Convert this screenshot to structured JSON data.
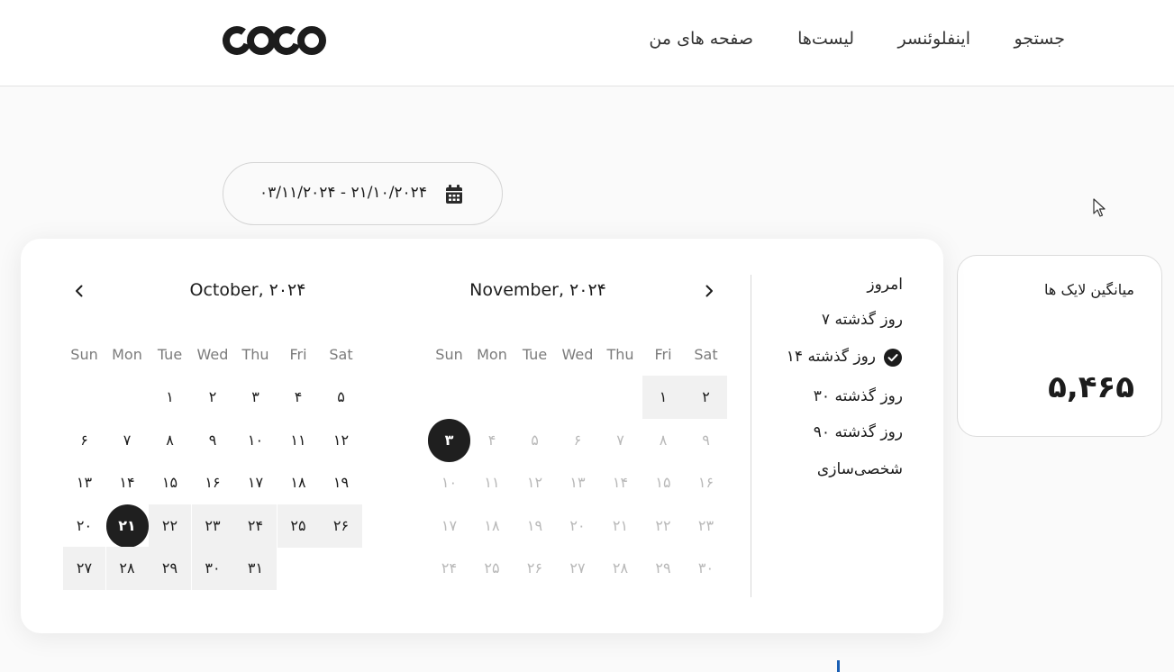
{
  "header": {
    "logo_text": "COCO",
    "nav": {
      "search": "جستجو",
      "influencer": "اینفلوئنسر",
      "lists": "لیست‌ها",
      "my_pages": "صفحه های من"
    }
  },
  "date_picker": {
    "range_text": "۰۳/۱۱/۲۰۲۴ - ۲۱/۱۰/۲۰۲۴",
    "icon": "calendar-icon"
  },
  "stat_card": {
    "title": "میانگین لایک ها",
    "value": "۵,۴۶۵"
  },
  "presets": {
    "today": "امروز",
    "last_7": "۷ روز گذشته",
    "last_14": "۱۴ روز گذشته",
    "last_30": "۳۰ روز گذشته",
    "last_90": "۹۰ روز گذشته",
    "custom": "شخصی‌سازی",
    "selected": "last_14"
  },
  "calendar": {
    "weekdays": [
      "Sun",
      "Mon",
      "Tue",
      "Wed",
      "Thu",
      "Fri",
      "Sat"
    ],
    "left": {
      "title": "October, ۲۰۲۴",
      "first_weekday": 2,
      "days": [
        "۱",
        "۲",
        "۳",
        "۴",
        "۵",
        "۶",
        "۷",
        "۸",
        "۹",
        "۱۰",
        "۱۱",
        "۱۲",
        "۱۳",
        "۱۴",
        "۱۵",
        "۱۶",
        "۱۷",
        "۱۸",
        "۱۹",
        "۲۰",
        "۲۱",
        "۲۲",
        "۲۳",
        "۲۴",
        "۲۵",
        "۲۶",
        "۲۷",
        "۲۸",
        "۲۹",
        "۳۰",
        "۳۱"
      ],
      "selected_day": 21,
      "range_from": 21,
      "range_to": 31,
      "muted_from": null
    },
    "right": {
      "title": "November, ۲۰۲۴",
      "first_weekday": 5,
      "days": [
        "۱",
        "۲",
        "۳",
        "۴",
        "۵",
        "۶",
        "۷",
        "۸",
        "۹",
        "۱۰",
        "۱۱",
        "۱۲",
        "۱۳",
        "۱۴",
        "۱۵",
        "۱۶",
        "۱۷",
        "۱۸",
        "۱۹",
        "۲۰",
        "۲۱",
        "۲۲",
        "۲۳",
        "۲۴",
        "۲۵",
        "۲۶",
        "۲۷",
        "۲۸",
        "۲۹",
        "۳۰"
      ],
      "selected_day": 3,
      "range_from": 1,
      "range_to": 2,
      "muted_from": 4
    }
  },
  "colors": {
    "selected_bg": "#1f1f1f",
    "range_bg": "#f1f1f1",
    "muted_text": "#b9b9b9",
    "accent_blue": "#1a5fb4"
  }
}
